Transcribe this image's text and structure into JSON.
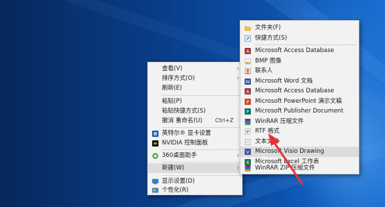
{
  "main_menu": {
    "items": [
      {
        "label": "查看(V)",
        "arrow": "›"
      },
      {
        "label": "排序方式(O)",
        "arrow": "›"
      },
      {
        "label": "刷新(E)"
      },
      {
        "label": "粘贴(P)"
      },
      {
        "label": "粘贴快捷方式(S)"
      },
      {
        "label": "撤消 重命名(U)",
        "shortcut": "Ctrl+Z"
      },
      {
        "label": "英特尔® 显卡设置"
      },
      {
        "label": "NVIDIA 控制面板"
      },
      {
        "label": "360桌面助手",
        "arrow": "›"
      },
      {
        "label": "新建(W)",
        "arrow": "›"
      },
      {
        "label": "显示设置(D)"
      },
      {
        "label": "个性化(R)"
      }
    ]
  },
  "new_submenu": {
    "items": [
      {
        "label": "文件夹(F)"
      },
      {
        "label": "快捷方式(S)"
      },
      {
        "label": "Microsoft Access Database"
      },
      {
        "label": "BMP 图像"
      },
      {
        "label": "联系人"
      },
      {
        "label": "Microsoft Word 文档"
      },
      {
        "label": "Microsoft Access Database"
      },
      {
        "label": "Microsoft PowerPoint 演示文稿"
      },
      {
        "label": "Microsoft Publisher Document"
      },
      {
        "label": "WinRAR 压缩文件"
      },
      {
        "label": "RTF 格式"
      },
      {
        "label": "文本文档"
      },
      {
        "label": "Microsoft Visio Drawing"
      },
      {
        "label": "Microsoft Excel 工作表"
      },
      {
        "label": "WinRAR ZIP 压缩文件"
      }
    ]
  },
  "colors": {
    "annotation_arrow": "#e8333a",
    "menu_bg": "#f2f2f2",
    "highlight": "#dcdcdc"
  }
}
